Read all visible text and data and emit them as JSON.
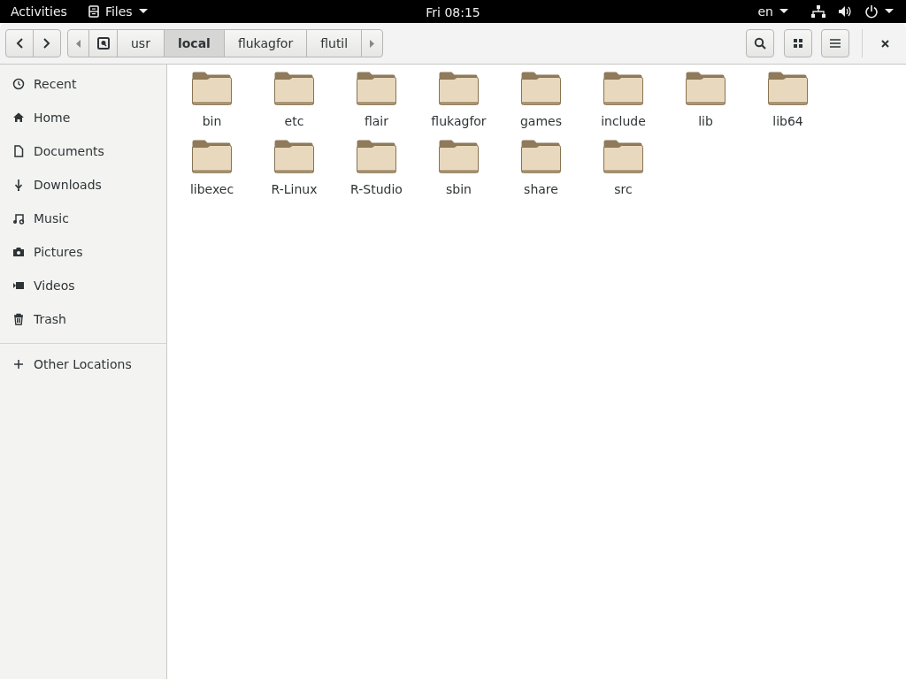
{
  "top_bar": {
    "activities": "Activities",
    "app_menu": "Files",
    "clock": "Fri 08:15",
    "keyboard_layout": "en"
  },
  "path_bar": {
    "segments": [
      {
        "label": "usr",
        "selected": false
      },
      {
        "label": "local",
        "selected": true
      },
      {
        "label": "flukagfor",
        "selected": false
      },
      {
        "label": "flutil",
        "selected": false
      }
    ]
  },
  "sidebar": {
    "items": [
      {
        "label": "Recent"
      },
      {
        "label": "Home"
      },
      {
        "label": "Documents"
      },
      {
        "label": "Downloads"
      },
      {
        "label": "Music"
      },
      {
        "label": "Pictures"
      },
      {
        "label": "Videos"
      },
      {
        "label": "Trash"
      }
    ],
    "other": {
      "label": "Other Locations"
    }
  },
  "folders": [
    "bin",
    "etc",
    "flair",
    "flukagfor",
    "games",
    "include",
    "lib",
    "lib64",
    "libexec",
    "R-Linux",
    "R-Studio",
    "sbin",
    "share",
    "src"
  ]
}
